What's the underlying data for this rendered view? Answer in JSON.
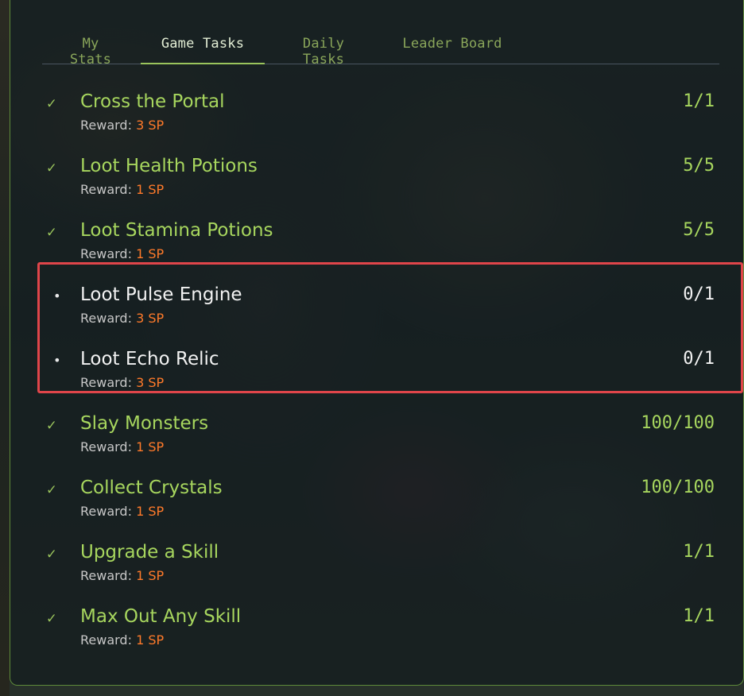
{
  "tabs": [
    {
      "label": "My Stats",
      "active": false
    },
    {
      "label": "Game Tasks",
      "active": true
    },
    {
      "label": "Daily Tasks",
      "active": false
    },
    {
      "label": "Leader Board",
      "active": false
    }
  ],
  "reward_prefix": "Reward:",
  "colors": {
    "accent_green": "#a7d65e",
    "reward_orange": "#ff7a2a",
    "pending_white": "#f2f2f2",
    "panel_border": "#5e8a3a",
    "highlight_red": "#e0454a"
  },
  "tasks": [
    {
      "title": "Cross the Portal",
      "reward": "3 SP",
      "progress": "1/1",
      "status": "complete",
      "icon": "check-icon"
    },
    {
      "title": "Loot Health Potions",
      "reward": "1 SP",
      "progress": "5/5",
      "status": "complete",
      "icon": "check-icon"
    },
    {
      "title": "Loot Stamina Potions",
      "reward": "1 SP",
      "progress": "5/5",
      "status": "complete",
      "icon": "check-icon"
    },
    {
      "title": "Loot Pulse Engine",
      "reward": "3 SP",
      "progress": "0/1",
      "status": "pending",
      "icon": "bullet-icon"
    },
    {
      "title": "Loot Echo Relic",
      "reward": "3 SP",
      "progress": "0/1",
      "status": "pending",
      "icon": "bullet-icon"
    },
    {
      "title": "Slay Monsters",
      "reward": "1 SP",
      "progress": "100/100",
      "status": "complete",
      "icon": "check-icon"
    },
    {
      "title": "Collect Crystals",
      "reward": "1 SP",
      "progress": "100/100",
      "status": "complete",
      "icon": "check-icon"
    },
    {
      "title": "Upgrade a Skill",
      "reward": "1 SP",
      "progress": "1/1",
      "status": "complete",
      "icon": "check-icon"
    },
    {
      "title": "Max Out Any Skill",
      "reward": "1 SP",
      "progress": "1/1",
      "status": "complete",
      "icon": "check-icon"
    }
  ]
}
